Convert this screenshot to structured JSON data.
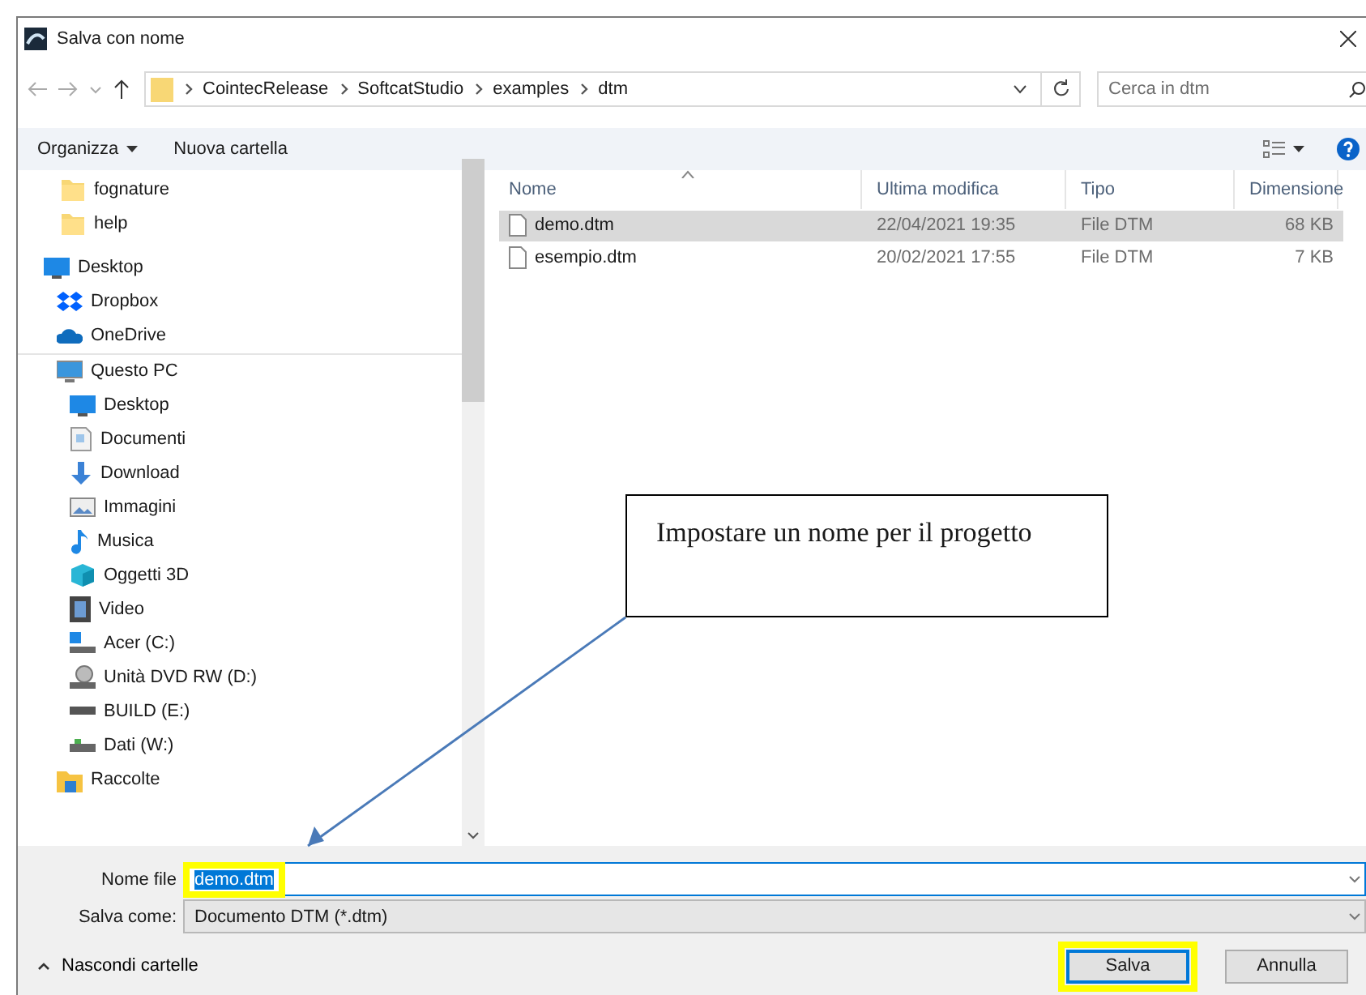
{
  "window": {
    "title": "Salva con nome"
  },
  "address": {
    "crumbs": [
      "CointecRelease",
      "SoftcatStudio",
      "examples",
      "dtm"
    ]
  },
  "search": {
    "placeholder": "Cerca in dtm"
  },
  "toolbar": {
    "organize": "Organizza",
    "new_folder": "Nuova cartella"
  },
  "sidebar": {
    "items": [
      {
        "label": "fognature",
        "kind": "folder"
      },
      {
        "label": "help",
        "kind": "folder"
      },
      {
        "label": "Desktop",
        "kind": "desktop"
      },
      {
        "label": "Dropbox",
        "kind": "dropbox"
      },
      {
        "label": "OneDrive",
        "kind": "cloud"
      },
      {
        "label": "Questo PC",
        "kind": "pc",
        "children": [
          {
            "label": "Desktop",
            "kind": "desktop"
          },
          {
            "label": "Documenti",
            "kind": "documents"
          },
          {
            "label": "Download",
            "kind": "download"
          },
          {
            "label": "Immagini",
            "kind": "pictures"
          },
          {
            "label": "Musica",
            "kind": "music"
          },
          {
            "label": "Oggetti 3D",
            "kind": "cube"
          },
          {
            "label": "Video",
            "kind": "video"
          },
          {
            "label": "Acer (C:)",
            "kind": "system-drive"
          },
          {
            "label": "Unità DVD RW (D:)",
            "kind": "dvd"
          },
          {
            "label": "BUILD (E:)",
            "kind": "drive"
          },
          {
            "label": "Dati (W:)",
            "kind": "network-drive"
          }
        ]
      },
      {
        "label": "Raccolte",
        "kind": "library"
      }
    ]
  },
  "table": {
    "columns": [
      "Nome",
      "Ultima modifica",
      "Tipo",
      "Dimensione"
    ],
    "rows": [
      {
        "name": "demo.dtm",
        "modified": "22/04/2021 19:35",
        "type": "File DTM",
        "size": "68 KB",
        "selected": true
      },
      {
        "name": "esempio.dtm",
        "modified": "20/02/2021 17:55",
        "type": "File DTM",
        "size": "7 KB",
        "selected": false
      }
    ]
  },
  "file_name": {
    "label": "Nome file",
    "value": "demo.dtm",
    "highlighted": true
  },
  "save_as": {
    "label": "Salva come:",
    "value": "Documento DTM (*.dtm)"
  },
  "hide_folders": "Nascondi cartelle",
  "buttons": [
    {
      "label": "Salva",
      "default": true,
      "highlighted": true
    },
    {
      "label": "Annulla",
      "default": false,
      "highlighted": false
    }
  ],
  "callout": {
    "text": "Impostare un nome per il progetto"
  }
}
